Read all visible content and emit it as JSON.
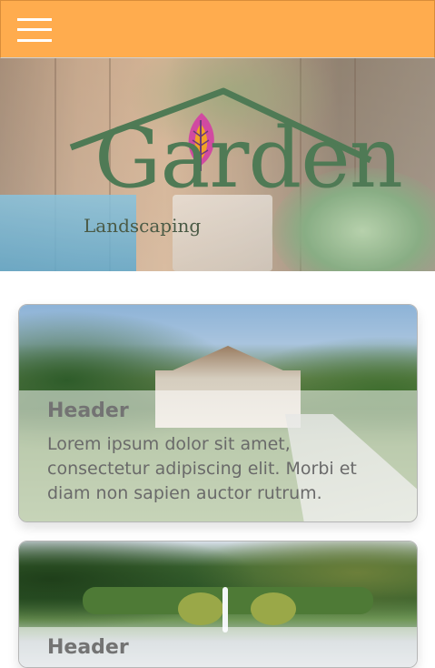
{
  "header": {
    "menu_icon": "hamburger-menu-icon",
    "background": "#ffac4e"
  },
  "hero": {
    "logo_word": "Garden",
    "logo_subtitle": "Landscaping",
    "logo_leaf_icon": "leaf-icon",
    "logo_colors": {
      "green": "#4f7a55",
      "leaf_pink": "#d14aa1",
      "leaf_orange": "#f0a227"
    }
  },
  "cards": [
    {
      "header": "Header",
      "body": "Lorem ipsum dolor sit amet, consectetur adipiscing elit. Morbi et diam non sapien auctor rutrum."
    },
    {
      "header": "Header"
    }
  ]
}
